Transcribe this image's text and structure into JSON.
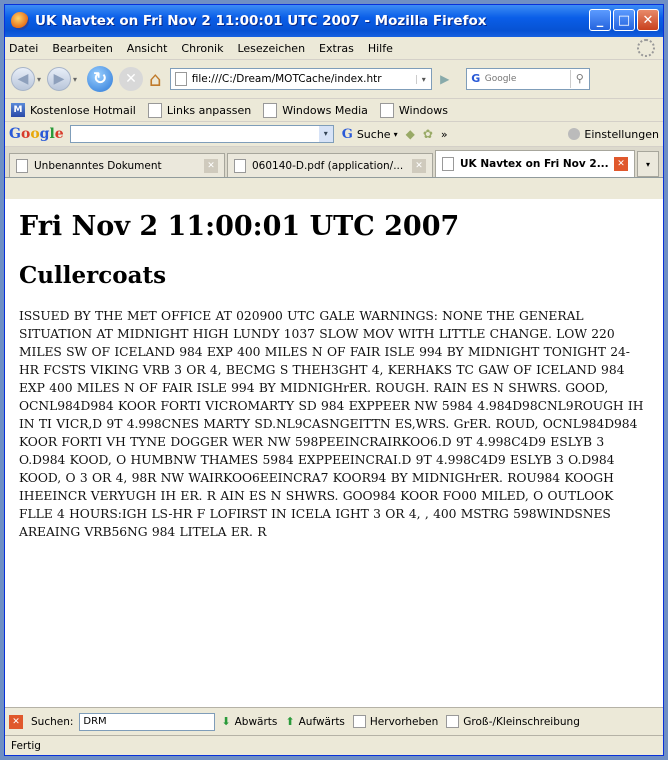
{
  "window": {
    "title": "UK Navtex on Fri Nov 2 11:00:01 UTC 2007 - Mozilla Firefox"
  },
  "menu": [
    "Datei",
    "Bearbeiten",
    "Ansicht",
    "Chronik",
    "Lesezeichen",
    "Extras",
    "Hilfe"
  ],
  "navbar": {
    "url": "file:///C:/Dream/MOTCache/index.htr",
    "search_placeholder": "Google"
  },
  "bookmarks": [
    "Kostenlose Hotmail",
    "Links anpassen",
    "Windows Media",
    "Windows"
  ],
  "google_toolbar": {
    "logo": "Google",
    "search_label": "Suche",
    "more": "»",
    "settings_label": "Einstellungen"
  },
  "tabs": [
    {
      "label": "Unbenanntes Dokument",
      "active": false
    },
    {
      "label": "060140-D.pdf (application/...",
      "active": false
    },
    {
      "label": "UK Navtex on Fri Nov 2...",
      "active": true
    }
  ],
  "page": {
    "heading": "Fri Nov 2 11:00:01 UTC 2007",
    "station": "Cullercoats",
    "message": "ISSUED BY THE MET OFFICE AT 020900 UTC GALE WARNINGS: NONE THE GENERAL SITUATION AT MIDNIGHT HIGH LUNDY 1037 SLOW MOV WITH LITTLE CHANGE. LOW 220 MILES SW OF ICELAND 984 EXP 400 MILES N OF FAIR ISLE 994 BY MIDNIGHT TONIGHT 24-HR FCSTS VIKING VRB 3 OR 4, BECMG S THEH3GHT 4, KERHAKS TC GAW OF ICELAND 984 EXP 400 MILES N OF FAIR ISLE 994 BY MIDNIGHrER. ROUGH. RAIN ES N SHWRS. GOOD, OCNL984D984 KOOR FORTI VICROMARTY SD 984 EXPPEER NW 5984 4.984D98CNL9ROUGH IH IN TI VICR,D 9T 4.998CNES MARTY SD.NL9CASNGEITTN ES,WRS. GrER. ROUD, OCNL984D984 KOOR FORTI VH TYNE DOGGER WER NW 598PEEINCRAIRKOO6.D 9T 4.998C4D9 ESLYB 3 O.D984 KOOD, O HUMBNW THAMES 5984 EXPPEEINCRAI.D 9T 4.998C4D9 ESLYB 3 O.D984 KOOD, O 3 OR 4, 98R NW WAIRKOO6EEINCRA7 KOOR94 BY MIDNIGHrER. ROU984 KOOGH IHEEINCR VERYUGH IH ER. R AIN ES N SHWRS. GOO984 KOOR FO00 MILED, O OUTLOOK FLLE 4 HOURS:IGH LS-HR F LOFIRST IN ICELA IGHT 3 OR 4, , 400 MSTRG 598WINDSNES AREAING VRB56NG 984 LITELA ER. R"
  },
  "findbar": {
    "label": "Suchen:",
    "value": "DRM",
    "down": "Abwärts",
    "up": "Aufwärts",
    "highlight": "Hervorheben",
    "matchcase": "Groß-/Kleinschreibung"
  },
  "status": {
    "text": "Fertig"
  }
}
